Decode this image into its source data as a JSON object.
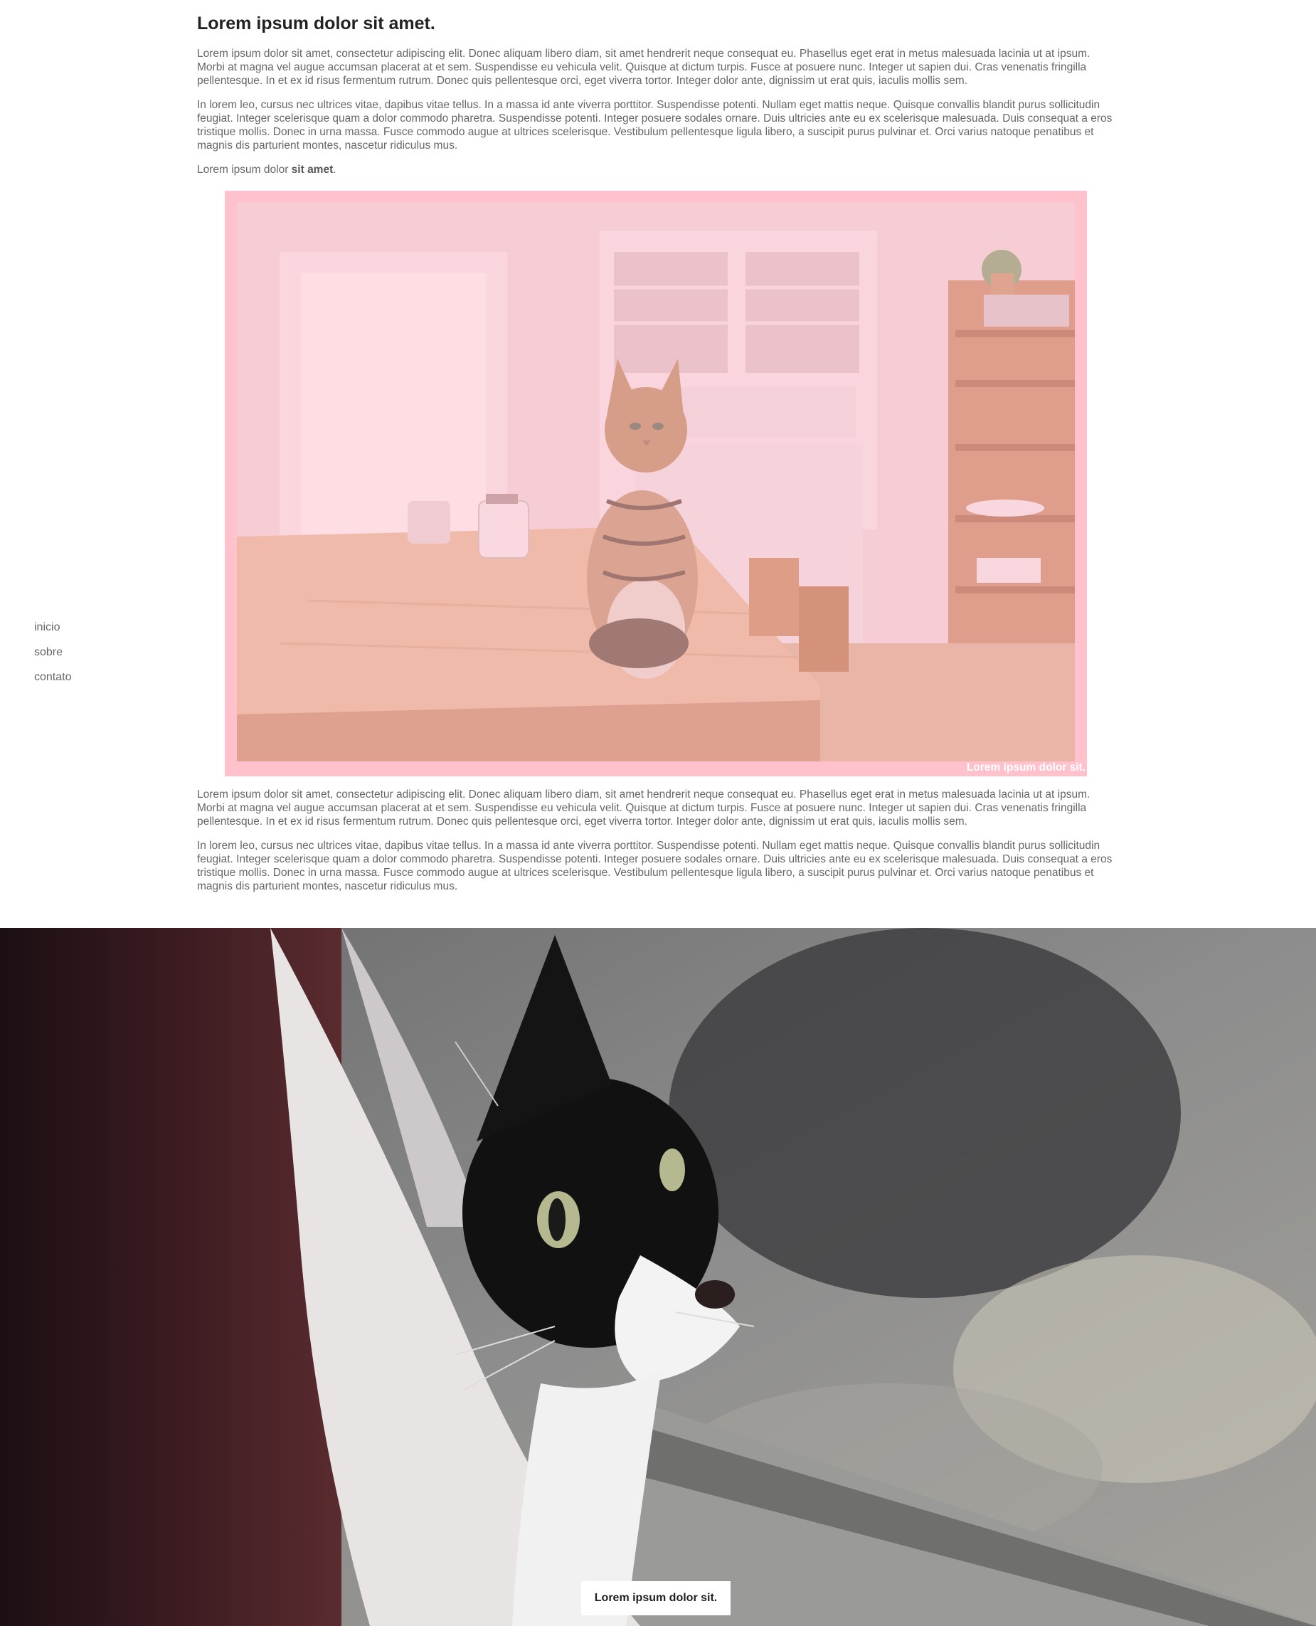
{
  "nav": {
    "items": [
      {
        "label": "inicio"
      },
      {
        "label": "sobre"
      },
      {
        "label": "contato"
      }
    ]
  },
  "article": {
    "title": "Lorem ipsum dolor sit amet.",
    "paragraph_1": "Lorem ipsum dolor sit amet, consectetur adipiscing elit. Donec aliquam libero diam, sit amet hendrerit neque consequat eu. Phasellus eget erat in metus malesuada lacinia ut at ipsum. Morbi at magna vel augue accumsan placerat at et sem. Suspendisse eu vehicula velit. Quisque at dictum turpis. Fusce at posuere nunc. Integer ut sapien dui. Cras venenatis fringilla pellentesque. In et ex id risus fermentum rutrum. Donec quis pellentesque orci, eget viverra tortor. Integer dolor ante, dignissim ut erat quis, iaculis mollis sem.",
    "paragraph_2": "In lorem leo, cursus nec ultrices vitae, dapibus vitae tellus. In a massa id ante viverra porttitor. Suspendisse potenti. Nullam eget mattis neque. Quisque convallis blandit purus sollicitudin feugiat. Integer scelerisque quam a dolor commodo pharetra. Suspendisse potenti. Integer posuere sodales ornare. Duis ultricies ante eu ex scelerisque malesuada. Duis consequat a eros tristique mollis. Donec in urna massa. Fusce commodo augue at ultrices scelerisque. Vestibulum pellentesque ligula libero, a suscipit purus pulvinar et. Orci varius natoque penatibus et magnis dis parturient montes, nascetur ridiculus mus.",
    "paragraph_3_prefix": "Lorem ipsum dolor ",
    "paragraph_3_bold": "sit amet",
    "paragraph_3_suffix": ".",
    "figure_caption": "Lorem ipsum dolor sit.",
    "paragraph_4": "Lorem ipsum dolor sit amet, consectetur adipiscing elit. Donec aliquam libero diam, sit amet hendrerit neque consequat eu. Phasellus eget erat in metus malesuada lacinia ut at ipsum. Morbi at magna vel augue accumsan placerat at et sem. Suspendisse eu vehicula velit. Quisque at dictum turpis. Fusce at posuere nunc. Integer ut sapien dui. Cras venenatis fringilla pellentesque. In et ex id risus fermentum rutrum. Donec quis pellentesque orci, eget viverra tortor. Integer dolor ante, dignissim ut erat quis, iaculis mollis sem.",
    "paragraph_5": "In lorem leo, cursus nec ultrices vitae, dapibus vitae tellus. In a massa id ante viverra porttitor. Suspendisse potenti. Nullam eget mattis neque. Quisque convallis blandit purus sollicitudin feugiat. Integer scelerisque quam a dolor commodo pharetra. Suspendisse potenti. Integer posuere sodales ornare. Duis ultricies ante eu ex scelerisque malesuada. Duis consequat a eros tristique mollis. Donec in urna massa. Fusce commodo augue at ultrices scelerisque. Vestibulum pellentesque ligula libero, a suscipit purus pulvinar et. Orci varius natoque penatibus et magnis dis parturient montes, nascetur ridiculus mus."
  },
  "hero": {
    "caption": "Lorem ipsum dolor sit."
  },
  "colors": {
    "frame_pink": "#ffc1cc",
    "text_gray": "#666666",
    "title_dark": "#222222"
  }
}
